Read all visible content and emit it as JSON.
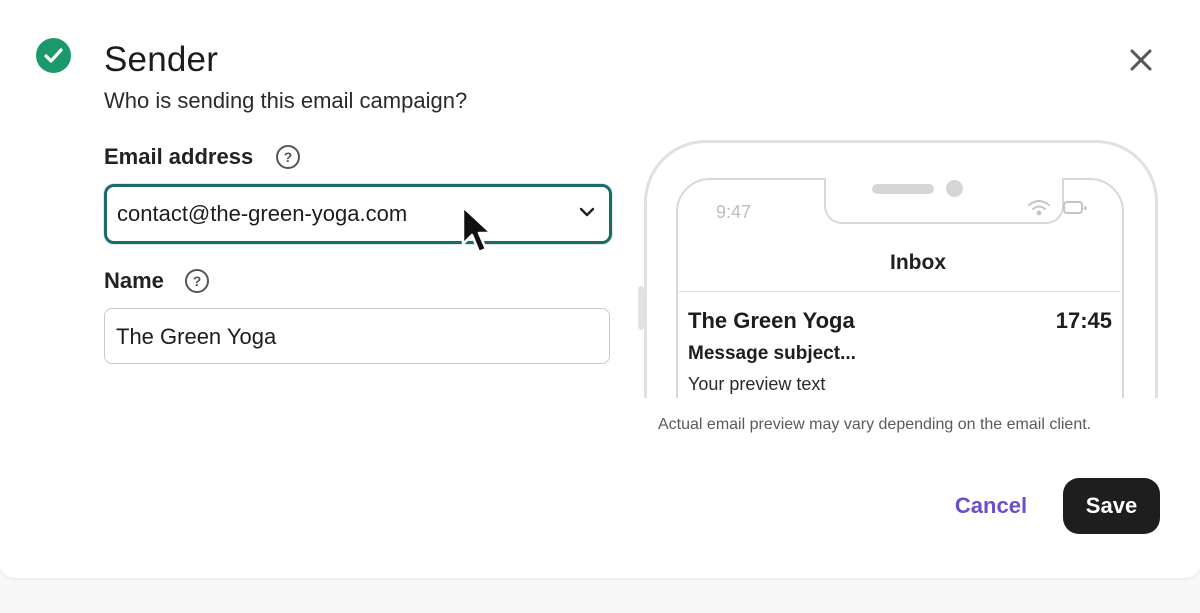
{
  "section": {
    "title": "Sender",
    "subtitle": "Who is sending this email campaign?"
  },
  "email_field": {
    "label": "Email address",
    "help_icon": "question-circle-icon",
    "value": "contact@the-green-yoga.com"
  },
  "name_field": {
    "label": "Name",
    "help_icon": "question-circle-icon",
    "value": "The Green Yoga"
  },
  "preview": {
    "status_time": "9:47",
    "inbox_title": "Inbox",
    "sender": "The Green Yoga",
    "time": "17:45",
    "subject": "Message subject...",
    "preview_text": "Your preview text",
    "disclaimer": "Actual email preview may vary depending on the email client."
  },
  "actions": {
    "cancel_label": "Cancel",
    "save_label": "Save"
  },
  "colors": {
    "check": "#1a9a6b",
    "focus_border": "#1c6b6b",
    "cancel": "#6a4fc8",
    "save_bg": "#1e1e1e"
  }
}
